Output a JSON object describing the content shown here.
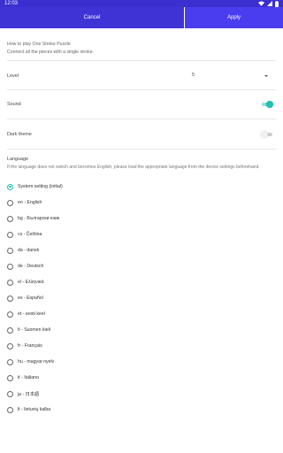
{
  "status_bar": {
    "time": "12:03",
    "icons": [
      "wifi-icon",
      "cellular-signal-icon",
      "battery-icon"
    ]
  },
  "toolbar": {
    "cancel_label": "Cancel",
    "apply_label": "Apply"
  },
  "howto": {
    "title": "How to play One Stroke Puzzle",
    "description": "Connect all the pieces with a single stroke."
  },
  "settings": {
    "level_label": "Level",
    "level_value": "5",
    "sound_label": "Sound",
    "sound_on": true,
    "dark_theme_label": "Dark theme",
    "dark_theme_on": false
  },
  "language": {
    "title": "Language",
    "note": "If the language does not switch and becomes English, please load the appropriate language from the device settings beforehand.",
    "selected_index": 0,
    "options": [
      "System setting (initial)",
      "en - English",
      "bg - Български език",
      "cs - Čeština",
      "da - dansk",
      "de - Deutsch",
      "el - Ελληνικά",
      "es - Español",
      "et - eesti keel",
      "fi - Suomen kieli",
      "fr - Français",
      "hu - magyar nyelv",
      "it - Italiano",
      "ja - 日本語",
      "lt - lietuvių kalba"
    ]
  },
  "colors": {
    "status_bar": "#3b2fd0",
    "toolbar_cancel": "#3f33d6",
    "toolbar_apply": "#4a3df0",
    "accent": "#1fc2b0"
  }
}
